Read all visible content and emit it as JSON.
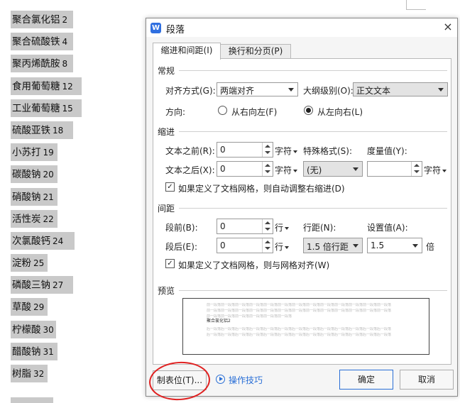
{
  "document": {
    "items": [
      {
        "text": "聚合氯化铝",
        "num": "2"
      },
      {
        "text": "聚合硫酸铁",
        "num": "4"
      },
      {
        "text": "聚丙烯酰胺",
        "num": "8"
      },
      {
        "text": "食用葡萄糖",
        "num": "12"
      },
      {
        "text": "工业葡萄糖",
        "num": "15"
      },
      {
        "text": "硫酸亚铁",
        "num": "18"
      },
      {
        "text": "小苏打",
        "num": "19"
      },
      {
        "text": "碳酸钠",
        "num": "20"
      },
      {
        "text": "硝酸钠",
        "num": "21"
      },
      {
        "text": "活性炭",
        "num": "22"
      },
      {
        "text": "次氯酸钙",
        "num": "24"
      },
      {
        "text": "淀粉",
        "num": "25"
      },
      {
        "text": "磷酸三钠",
        "num": "27"
      },
      {
        "text": "草酸",
        "num": "29"
      },
      {
        "text": "柠檬酸",
        "num": "30"
      },
      {
        "text": "醋酸钠",
        "num": "31"
      },
      {
        "text": "树脂",
        "num": "32"
      }
    ]
  },
  "dialog": {
    "app_icon": "W",
    "title": "段落",
    "close": "×",
    "tabs": {
      "indent_spacing": "缩进和间距(I)",
      "line_page": "换行和分页(P)"
    },
    "general": {
      "heading": "常规",
      "align_label": "对齐方式(G):",
      "align_value": "两端对齐",
      "outline_label": "大纲级别(O):",
      "outline_value": "正文文本",
      "direction_label": "方向:",
      "rtl_label": "从右向左(F)",
      "ltr_label": "从左向右(L)"
    },
    "indent": {
      "heading": "缩进",
      "before_label": "文本之前(R):",
      "before_value": "0",
      "before_unit": "字符",
      "after_label": "文本之后(X):",
      "after_value": "0",
      "after_unit": "字符",
      "special_label": "特殊格式(S):",
      "special_value": "(无)",
      "measure_label": "度量值(Y):",
      "measure_value": "",
      "measure_unit": "字符",
      "auto_adjust": "如果定义了文档网格，则自动调整右缩进(D)"
    },
    "spacing": {
      "heading": "间距",
      "before_label": "段前(B):",
      "before_value": "0",
      "before_unit": "行",
      "after_label": "段后(E):",
      "after_value": "0",
      "after_unit": "行",
      "line_label": "行距(N):",
      "line_value": "1.5 倍行距",
      "setting_label": "设置值(A):",
      "setting_value": "1.5",
      "setting_unit": "倍",
      "snap_grid": "如果定义了文档网格，则与网格对齐(W)"
    },
    "preview": {
      "heading": "预览",
      "prev_text": "前一段落前一段落前一段落前一段落前一段落前一段落前一段落前一段落前一段落前一段落前一段落前一段落前一段落",
      "sample_text": "聚合氯化铝2",
      "next_text": "后一段落后一段落后一段落后一段落后一段落后一段落后一段落后一段落后一段落后一段落后一段落后一段落后一段落"
    },
    "buttons": {
      "tabs": "制表位(T)...",
      "tips": "操作技巧",
      "ok": "确定",
      "cancel": "取消"
    }
  },
  "colors": {
    "accent": "#2a6fd6",
    "highlight": "#c9c9c9",
    "annotation": "#e02020"
  }
}
